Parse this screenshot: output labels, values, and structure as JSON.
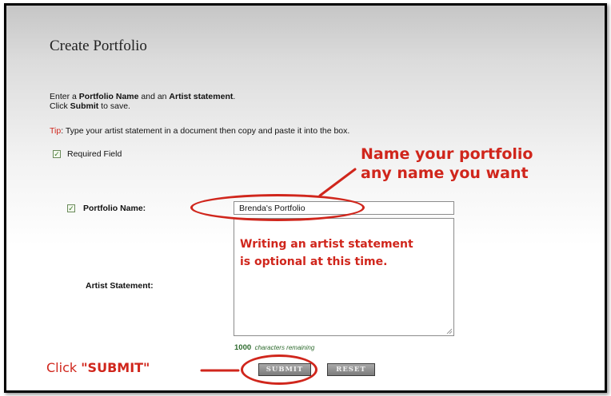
{
  "page": {
    "title": "Create Portfolio",
    "intro_line1_a": "Enter a ",
    "intro_line1_b": "Portfolio Name",
    "intro_line1_c": " and an ",
    "intro_line1_d": "Artist statement",
    "intro_line1_e": ".",
    "intro_line2_a": "Click ",
    "intro_line2_b": "Submit",
    "intro_line2_c": " to save.",
    "tip_label": "Tip",
    "tip_text": ": Type your artist statement in a document then copy and paste it into the box.",
    "required_field": "Required Field",
    "check_mark": "✓"
  },
  "form": {
    "portfolio_name_label": "Portfolio Name:",
    "portfolio_name_value": "Brenda's Portfolio",
    "artist_statement_label": "Artist Statement:",
    "chars_count": "1000",
    "chars_text": "characters remaining",
    "submit_label": "SUBMIT",
    "reset_label": "RESET"
  },
  "annotations": {
    "name_line1": "Name your portfolio",
    "name_line2": "any name you want",
    "statement_line1": "Writing an artist statement",
    "statement_line2": "is optional at this time.",
    "click_prefix": "Click ",
    "click_target": "\"SUBMIT\""
  },
  "colors": {
    "annotation_red": "#d0261c",
    "tip_red": "#d0261c",
    "checkbox_green": "#3a7a2a",
    "counter_green": "#2e6b2e"
  }
}
